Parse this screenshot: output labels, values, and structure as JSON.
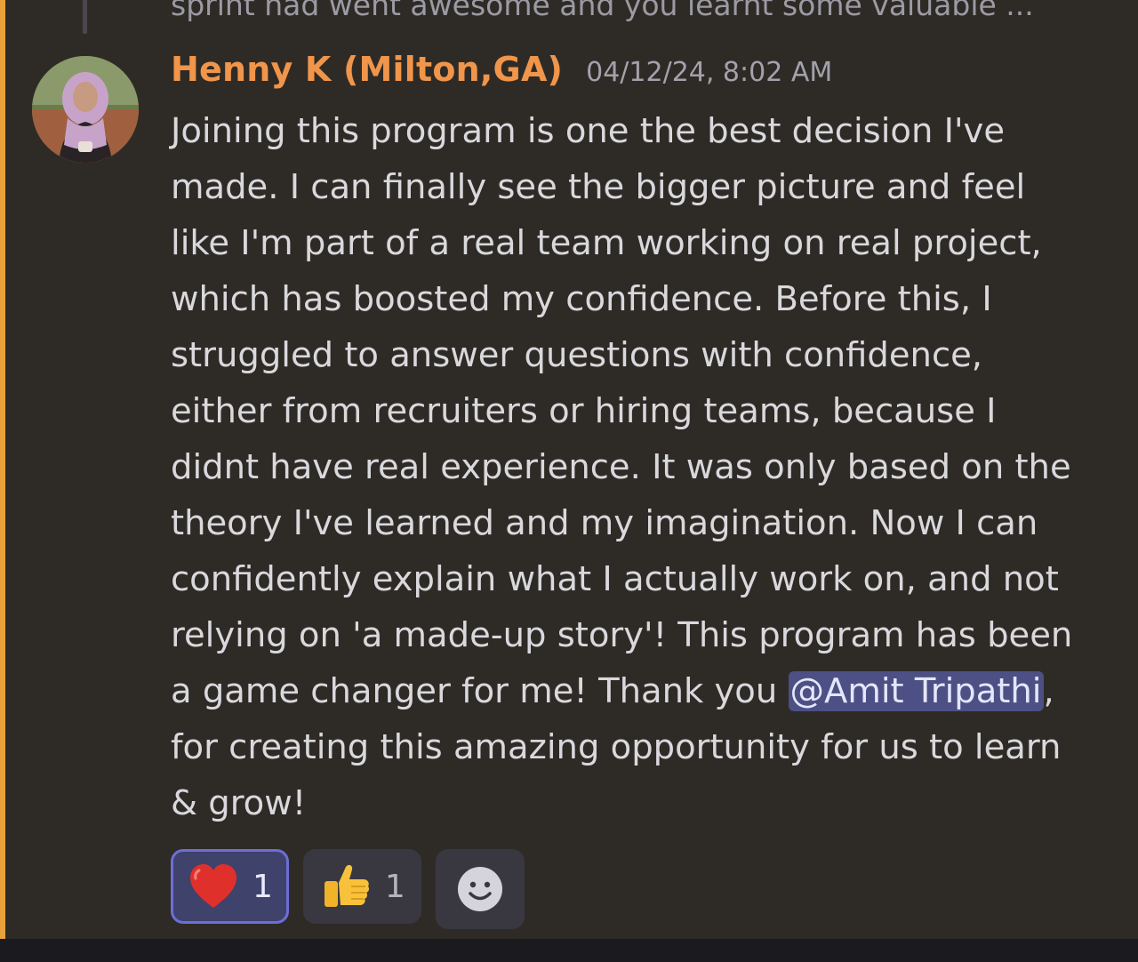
{
  "reply": {
    "preview_text": "sprint had went awesome and you learnt some valuable ..."
  },
  "message": {
    "author": "Henny K (Milton,GA)",
    "timestamp": "04/12/24, 8:02 AM",
    "lines": [
      "Joining this program is one the best decision I've",
      "made. I can finally see the bigger picture and feel",
      "like I'm part of a real team working on real project,",
      "which has boosted my confidence. Before this, I",
      "struggled to answer questions with confidence,",
      "either from recruiters or hiring teams, because I",
      "didnt have real experience. It was only based on the",
      "theory I've learned and my imagination. Now I can",
      "confidently explain what I actually work on, and not",
      "relying on 'a made-up story'! This program has been"
    ],
    "line11_before": "a game changer for me! Thank you ",
    "mention": "@Amit Tripathi",
    "line11_after": ",",
    "line12": "for creating this amazing opportunity for us to learn",
    "line13": "& grow!"
  },
  "reactions": [
    {
      "emoji": "heart-emoji",
      "count": "1",
      "active": true
    },
    {
      "emoji": "thumbs-up-emoji",
      "count": "1",
      "active": false
    }
  ],
  "add_reaction": {
    "icon": "smiley-add-icon"
  },
  "colors": {
    "background": "#2e2b27",
    "accent_bar": "#e9a23b",
    "author": "#f0954a",
    "mention_bg": "#4c5084",
    "active_reaction_border": "#6b6fd6"
  }
}
